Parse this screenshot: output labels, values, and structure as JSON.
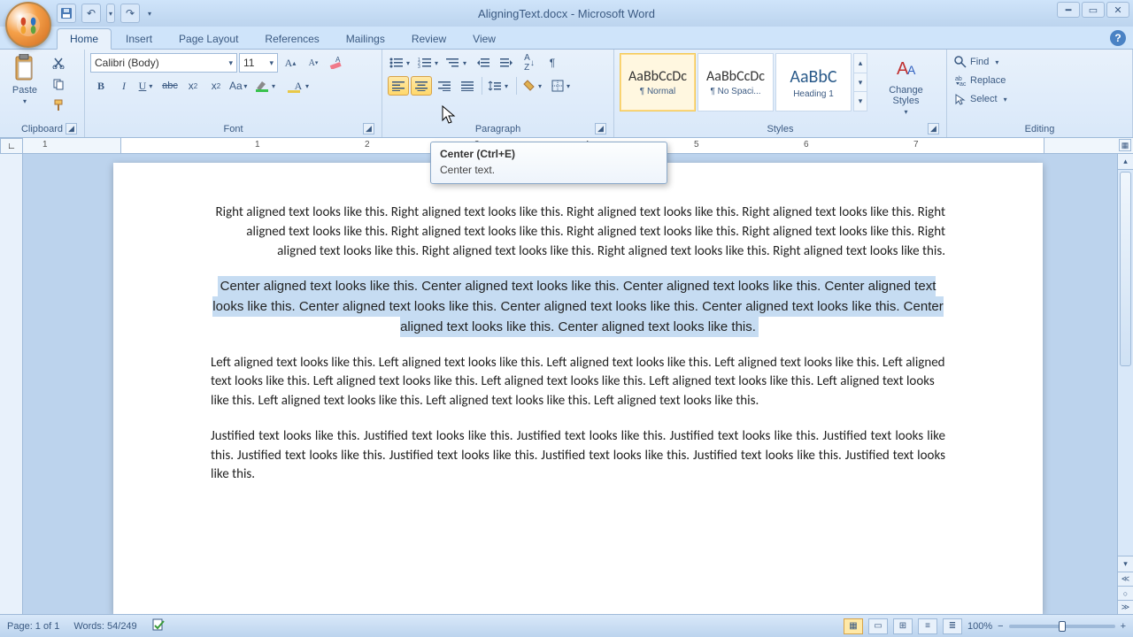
{
  "title": "AligningText.docx - Microsoft Word",
  "tabs": [
    "Home",
    "Insert",
    "Page Layout",
    "References",
    "Mailings",
    "Review",
    "View"
  ],
  "active_tab": "Home",
  "clipboard": {
    "label": "Clipboard",
    "paste": "Paste"
  },
  "font": {
    "label": "Font",
    "family": "Calibri (Body)",
    "size": "11"
  },
  "paragraph": {
    "label": "Paragraph"
  },
  "styles": {
    "label": "Styles",
    "change": "Change Styles",
    "items": [
      {
        "preview": "AaBbCcDc",
        "name": "¶ Normal"
      },
      {
        "preview": "AaBbCcDc",
        "name": "¶ No Spaci..."
      },
      {
        "preview": "AaBbC",
        "name": "Heading 1"
      }
    ]
  },
  "editing": {
    "label": "Editing",
    "find": "Find",
    "replace": "Replace",
    "select": "Select"
  },
  "tooltip": {
    "title": "Center (Ctrl+E)",
    "body": "Center text."
  },
  "ruler_numbers": [
    "1",
    "1",
    "2",
    "3",
    "4",
    "5",
    "6",
    "7"
  ],
  "document": {
    "right": "Right aligned text looks like this. Right aligned text looks like this. Right aligned text looks like this. Right aligned text looks like this. Right aligned text looks like this. Right aligned text looks like this. Right aligned text looks like this. Right aligned text looks like this. Right aligned text looks like this. Right aligned text looks like this. Right aligned text looks like this. Right aligned text looks like this.",
    "center": "Center aligned text looks like this. Center aligned text looks like this. Center aligned text looks like this. Center aligned text looks like this. Center aligned text looks like this. Center aligned text looks like this. Center aligned text looks like this. Center aligned text looks like this. Center aligned text looks like this.",
    "left": "Left aligned text looks like this. Left aligned text looks like this. Left aligned text looks like this. Left aligned text looks like this. Left aligned text looks like this. Left aligned text looks like this. Left aligned text looks like this. Left aligned text looks like this. Left aligned text looks like this. Left aligned text looks like this. Left aligned text looks like this. Left aligned text looks like this.",
    "justify": "Justified text looks like this. Justified text looks like this. Justified text looks like this. Justified text looks like this. Justified text looks like this. Justified text looks like this. Justified text looks like this. Justified text looks like this. Justified text looks like this. Justified text looks like this."
  },
  "status": {
    "page": "Page: 1 of 1",
    "words": "Words: 54/249",
    "zoom": "100%"
  }
}
